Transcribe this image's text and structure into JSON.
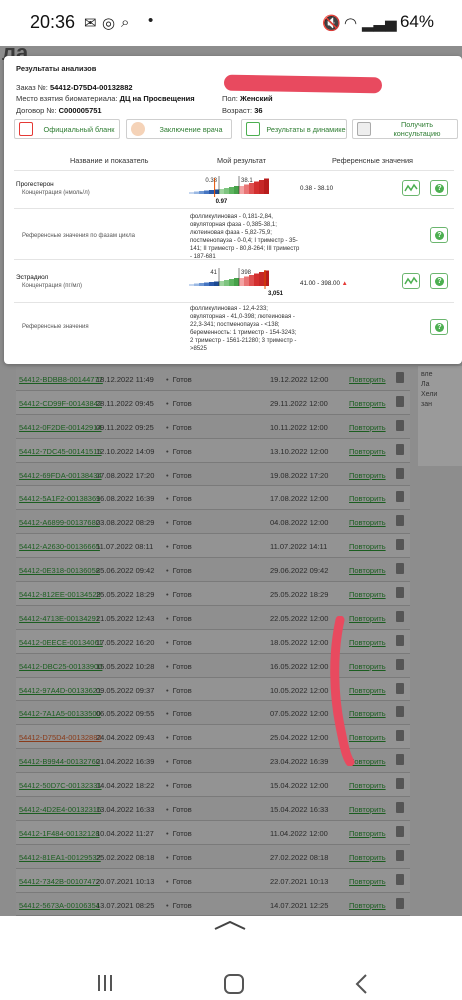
{
  "status_bar": {
    "time": "20:36",
    "battery": "64%"
  },
  "background": {
    "page_title_fragment": "ла",
    "side_text": [
      "вле",
      "Ла",
      "Хели",
      "зан"
    ],
    "rows": [
      {
        "id": "54412-BDBB8-00144777",
        "created": "18.12.2022 11:49",
        "status": "Готов",
        "ready": "19.12.2022 12:00",
        "repeat": "Повторить"
      },
      {
        "id": "54412-CD99F-00143842",
        "created": "28.11.2022 09:45",
        "status": "Готов",
        "ready": "29.11.2022 12:00",
        "repeat": "Повторить"
      },
      {
        "id": "54412-0F2DE-00142914",
        "created": "09.11.2022 09:25",
        "status": "Готов",
        "ready": "10.11.2022 12:00",
        "repeat": "Повторить"
      },
      {
        "id": "54412-7DC45-00141515",
        "created": "12.10.2022 14:09",
        "status": "Готов",
        "ready": "13.10.2022 12:00",
        "repeat": "Повторить"
      },
      {
        "id": "54412-69FDA-00138434",
        "created": "17.08.2022 17:20",
        "status": "Готов",
        "ready": "19.08.2022 17:20",
        "repeat": "Повторить"
      },
      {
        "id": "54412-5A1F2-00138369",
        "created": "16.08.2022 16:39",
        "status": "Готов",
        "ready": "17.08.2022 12:00",
        "repeat": "Повторить"
      },
      {
        "id": "54412-A6899-00137682",
        "created": "03.08.2022 08:29",
        "status": "Готов",
        "ready": "04.08.2022 12:00",
        "repeat": "Повторить"
      },
      {
        "id": "54412-A2630-00136665",
        "created": "11.07.2022 08:11",
        "status": "Готов",
        "ready": "11.07.2022 14:11",
        "repeat": "Повторить"
      },
      {
        "id": "54412-0E318-00136058",
        "created": "25.06.2022 09:42",
        "status": "Готов",
        "ready": "29.06.2022 09:42",
        "repeat": "Повторить"
      },
      {
        "id": "54412-812EE-00134529",
        "created": "25.05.2022 18:29",
        "status": "Готов",
        "ready": "25.05.2022 18:29",
        "repeat": "Повторить"
      },
      {
        "id": "54412-4713E-00134291",
        "created": "21.05.2022 12:43",
        "status": "Готов",
        "ready": "22.05.2022 12:00",
        "repeat": "Повторить"
      },
      {
        "id": "54412-0EECE-00134061",
        "created": "17.05.2022 16:20",
        "status": "Готов",
        "ready": "18.05.2022 12:00",
        "repeat": "Повторить"
      },
      {
        "id": "54412-DBC25-00133900",
        "created": "15.05.2022 10:28",
        "status": "Готов",
        "ready": "16.05.2022 12:00",
        "repeat": "Повторить"
      },
      {
        "id": "54412-97A4D-00133621",
        "created": "09.05.2022 09:37",
        "status": "Готов",
        "ready": "10.05.2022 12:00",
        "repeat": "Повторить"
      },
      {
        "id": "54412-7A1A5-00133500",
        "created": "06.05.2022 09:55",
        "status": "Готов",
        "ready": "07.05.2022 12:00",
        "repeat": "Повторить"
      },
      {
        "id": "54412-D75D4-00132882",
        "created": "24.04.2022 09:43",
        "status": "Готов",
        "ready": "25.04.2022 12:00",
        "repeat": "Повторить",
        "highlight": true
      },
      {
        "id": "54412-B9944-00132760",
        "created": "21.04.2022 16:39",
        "status": "Готов",
        "ready": "23.04.2022 16:39",
        "repeat": "Повторить"
      },
      {
        "id": "54412-50D7C-00132331",
        "created": "14.04.2022 18:22",
        "status": "Готов",
        "ready": "15.04.2022 12:00",
        "repeat": "Повторить"
      },
      {
        "id": "54412-4D2E4-00132316",
        "created": "13.04.2022 16:33",
        "status": "Готов",
        "ready": "15.04.2022 16:33",
        "repeat": "Повторить"
      },
      {
        "id": "54412-1F484-00132128",
        "created": "10.04.2022 11:27",
        "status": "Готов",
        "ready": "11.04.2022 12:00",
        "repeat": "Повторить"
      },
      {
        "id": "54412-81EA1-00129532",
        "created": "25.02.2022 08:18",
        "status": "Готов",
        "ready": "27.02.2022 08:18",
        "repeat": "Повторить"
      },
      {
        "id": "54412-7342B-00107472",
        "created": "20.07.2021 10:13",
        "status": "Готов",
        "ready": "22.07.2021 10:13",
        "repeat": "Повторить"
      },
      {
        "id": "54412-5673A-00106354",
        "created": "13.07.2021 08:25",
        "status": "Готов",
        "ready": "14.07.2021 12:25",
        "repeat": "Повторить"
      }
    ]
  },
  "modal": {
    "title": "Результаты анализов",
    "order_label": "Заказ №:",
    "order_value": "54412-D75D4-00132882",
    "place_label": "Место взятия биоматериала:",
    "place_value": "ДЦ на Просвещения",
    "contract_label": "Договор №:",
    "contract_value": "C000005751",
    "sex_label": "Пол:",
    "sex_value": "Женский",
    "age_label": "Возраст:",
    "age_value": "36",
    "buttons": {
      "official": "Официальный бланк",
      "conclusion": "Заключение врача",
      "dynamics": "Результаты в динамике",
      "consult": "Получить консультацию"
    },
    "table_headers": {
      "name": "Название и показатель",
      "result": "Мой результат",
      "reference": "Референсные значения"
    },
    "tests": [
      {
        "name": "Прогестерон",
        "unit": "Концентрация (нмоль/л)",
        "low": "0.38",
        "high": "38.1",
        "result": "0.97",
        "reference": "0.38 - 38.10",
        "fraction": 0.32,
        "ref_label": "Референсные значения по фазам цикла",
        "ref_text": [
          "фолликулиновая - 0,181-2,84,",
          "овуляторная фаза - 0,385-38,1;",
          "лютеиновая фаза - 5,82-75,9;",
          "постменопауза - 0-0,4; I триместр - 35-",
          "141; II триместр - 80,8-264; III триместр",
          "- 187-681"
        ]
      },
      {
        "name": "Эстрадиол",
        "unit": "Концентрация (пг/мл)",
        "low": "41",
        "high": "398",
        "result": "3,051",
        "reference": "41.00 - 398.00",
        "fraction": 0.95,
        "ref_label": "Референсные значения",
        "ref_text": [
          "фолликулиновая - 12,4-233;",
          "овуляторная - 41,0-398; лютеиновая -",
          "22,3-341; постменопауза - <138;",
          "беременность: 1 триместр - 154-3243;",
          "2 триместр - 1561-21280; 3 триместр -",
          ">8525"
        ]
      }
    ]
  },
  "colors": {
    "accent_green": "#4caf50",
    "link_green": "#2e7d32",
    "marker_red": "#e84a5f"
  }
}
